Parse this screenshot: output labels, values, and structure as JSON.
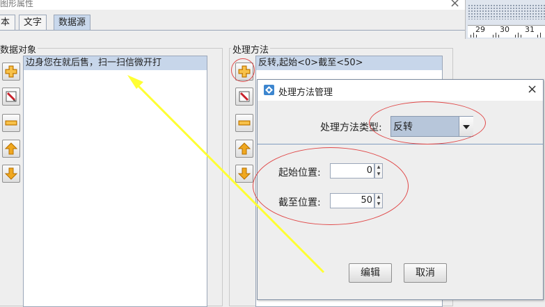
{
  "outer_dialog": {
    "title": "图形属性",
    "close": "×"
  },
  "tabs": [
    {
      "label": "本"
    },
    {
      "label": "文字"
    },
    {
      "label": "数据源",
      "active": true
    }
  ],
  "data_object": {
    "group_title": "数据对象",
    "items": [
      "边身您在就后售，扫一扫信微开打"
    ],
    "selected_index": 0
  },
  "processing": {
    "group_title": "处理方法",
    "items": [
      "反转,起始<0>截至<50>"
    ],
    "selected_index": 0
  },
  "side_buttons": {
    "icons": [
      "add-icon",
      "edit-icon",
      "remove-icon",
      "move-up-icon",
      "move-down-icon"
    ]
  },
  "ruler": {
    "labels": [
      "29",
      "30",
      "31"
    ]
  },
  "inner_dialog": {
    "title": "处理方法管理",
    "close": "×",
    "type_label": "处理方法类型:",
    "type_value": "反转",
    "start_label": "起始位置:",
    "start_value": "0",
    "end_label": "截至位置:",
    "end_value": "50",
    "edit_button": "编辑",
    "cancel_button": "取消"
  },
  "colors": {
    "accent_selection": "#c7d6ea",
    "annotation_red": "#e04848",
    "annotation_arrow": "#ffff33"
  }
}
